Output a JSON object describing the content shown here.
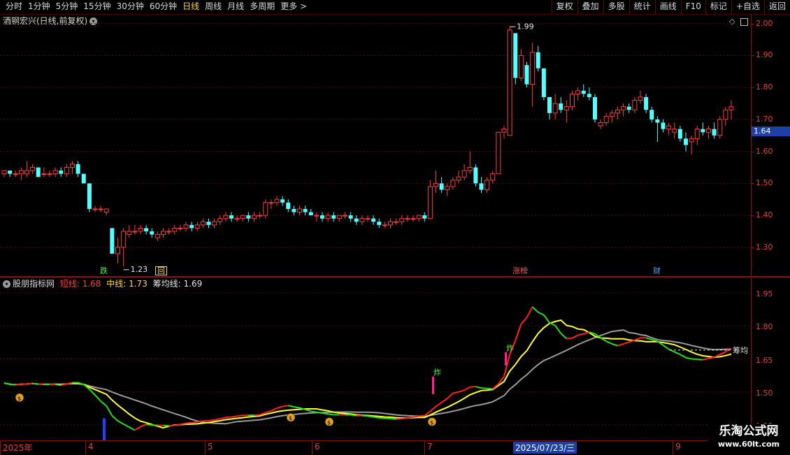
{
  "toolbar": {
    "periods": [
      "分时",
      "1分钟",
      "5分钟",
      "15分钟",
      "30分钟",
      "60分钟",
      "日线",
      "周线",
      "月线",
      "多周期",
      "更多 >"
    ],
    "active_period": "日线",
    "tools": [
      "复权",
      "叠加",
      "多股",
      "统计",
      "画线",
      "F10",
      "标记",
      "+自选",
      "返回"
    ]
  },
  "main_panel": {
    "title": "酒钢宏兴(日线,前复权)",
    "high_label": "1.99",
    "low_label": "1.23",
    "current_price": "1.64",
    "y_ticks": [
      "2.00",
      "1.90",
      "1.80",
      "1.70",
      "1.60",
      "1.50",
      "1.40",
      "1.30"
    ],
    "markers": [
      {
        "text": "跌",
        "color": "#3cff3c"
      },
      {
        "text": "回",
        "color": "#ffd24a"
      },
      {
        "text": "涨榜",
        "color": "#ff5050"
      },
      {
        "text": "财",
        "color": "#5aa0ff"
      }
    ]
  },
  "indicator_panel": {
    "name": "股朋指标网",
    "short_label": "短线: 1.68",
    "mid_label": "中线: 1.73",
    "avg_label": "筹均线: 1.69",
    "y_ticks": [
      "1.95",
      "1.80",
      "1.65",
      "1.50",
      "1.35"
    ],
    "end_label": "筹均",
    "signal_text": "炸"
  },
  "date_axis": {
    "labels": [
      "2025年",
      "4",
      "5",
      "6",
      "7",
      "2025/07/23/三",
      "9"
    ]
  },
  "watermark": {
    "line1": "乐淘公式网",
    "line2": "www.60lt.com"
  },
  "colors": {
    "up": "#ff3c3c",
    "down": "#54ffff",
    "axis": "#e04040"
  },
  "chart_data": {
    "type": "candlestick",
    "ylim": [
      1.21,
      2.03
    ],
    "candles": [
      [
        1.53,
        1.54,
        1.52,
        1.54
      ],
      [
        1.54,
        1.54,
        1.52,
        1.53
      ],
      [
        1.53,
        1.54,
        1.52,
        1.53
      ],
      [
        1.53,
        1.55,
        1.51,
        1.54
      ],
      [
        1.53,
        1.57,
        1.52,
        1.54
      ],
      [
        1.54,
        1.56,
        1.53,
        1.55
      ],
      [
        1.55,
        1.55,
        1.52,
        1.52
      ],
      [
        1.53,
        1.55,
        1.52,
        1.53
      ],
      [
        1.53,
        1.54,
        1.52,
        1.53
      ],
      [
        1.53,
        1.55,
        1.52,
        1.54
      ],
      [
        1.54,
        1.55,
        1.52,
        1.53
      ],
      [
        1.53,
        1.56,
        1.52,
        1.55
      ],
      [
        1.55,
        1.57,
        1.53,
        1.56
      ],
      [
        1.56,
        1.57,
        1.52,
        1.53
      ],
      [
        1.53,
        1.53,
        1.5,
        1.5
      ],
      [
        1.5,
        1.5,
        1.41,
        1.42
      ],
      [
        1.42,
        1.43,
        1.41,
        1.42
      ],
      [
        1.42,
        1.43,
        1.41,
        1.42
      ],
      [
        1.41,
        1.42,
        1.4,
        1.42
      ],
      [
        1.36,
        1.36,
        1.28,
        1.28
      ],
      [
        1.28,
        1.33,
        1.25,
        1.3
      ],
      [
        1.3,
        1.36,
        1.24,
        1.35
      ],
      [
        1.34,
        1.37,
        1.33,
        1.35
      ],
      [
        1.35,
        1.37,
        1.34,
        1.35
      ],
      [
        1.35,
        1.37,
        1.34,
        1.36
      ],
      [
        1.36,
        1.37,
        1.34,
        1.35
      ],
      [
        1.35,
        1.36,
        1.33,
        1.34
      ],
      [
        1.33,
        1.35,
        1.32,
        1.34
      ],
      [
        1.34,
        1.36,
        1.33,
        1.35
      ],
      [
        1.35,
        1.36,
        1.34,
        1.35
      ],
      [
        1.35,
        1.37,
        1.34,
        1.36
      ],
      [
        1.36,
        1.37,
        1.35,
        1.36
      ],
      [
        1.36,
        1.38,
        1.35,
        1.37
      ],
      [
        1.37,
        1.38,
        1.35,
        1.36
      ],
      [
        1.36,
        1.38,
        1.35,
        1.37
      ],
      [
        1.37,
        1.39,
        1.36,
        1.38
      ],
      [
        1.38,
        1.39,
        1.36,
        1.37
      ],
      [
        1.37,
        1.39,
        1.36,
        1.38
      ],
      [
        1.38,
        1.4,
        1.37,
        1.39
      ],
      [
        1.39,
        1.41,
        1.38,
        1.4
      ],
      [
        1.4,
        1.41,
        1.38,
        1.39
      ],
      [
        1.39,
        1.4,
        1.38,
        1.39
      ],
      [
        1.39,
        1.4,
        1.38,
        1.4
      ],
      [
        1.4,
        1.41,
        1.38,
        1.39
      ],
      [
        1.39,
        1.41,
        1.38,
        1.4
      ],
      [
        1.4,
        1.41,
        1.39,
        1.4
      ],
      [
        1.4,
        1.45,
        1.39,
        1.44
      ],
      [
        1.44,
        1.45,
        1.42,
        1.44
      ],
      [
        1.44,
        1.46,
        1.43,
        1.45
      ],
      [
        1.45,
        1.46,
        1.43,
        1.44
      ],
      [
        1.44,
        1.45,
        1.41,
        1.42
      ],
      [
        1.42,
        1.43,
        1.4,
        1.41
      ],
      [
        1.41,
        1.43,
        1.4,
        1.42
      ],
      [
        1.42,
        1.43,
        1.4,
        1.41
      ],
      [
        1.41,
        1.42,
        1.4,
        1.4
      ],
      [
        1.4,
        1.41,
        1.38,
        1.4
      ],
      [
        1.4,
        1.41,
        1.38,
        1.39
      ],
      [
        1.39,
        1.41,
        1.38,
        1.4
      ],
      [
        1.4,
        1.41,
        1.38,
        1.39
      ],
      [
        1.39,
        1.4,
        1.38,
        1.4
      ],
      [
        1.4,
        1.41,
        1.39,
        1.4
      ],
      [
        1.4,
        1.41,
        1.38,
        1.39
      ],
      [
        1.39,
        1.4,
        1.37,
        1.38
      ],
      [
        1.38,
        1.4,
        1.37,
        1.39
      ],
      [
        1.39,
        1.4,
        1.38,
        1.39
      ],
      [
        1.39,
        1.4,
        1.37,
        1.38
      ],
      [
        1.38,
        1.39,
        1.36,
        1.37
      ],
      [
        1.37,
        1.38,
        1.36,
        1.37
      ],
      [
        1.37,
        1.39,
        1.36,
        1.38
      ],
      [
        1.38,
        1.39,
        1.37,
        1.38
      ],
      [
        1.38,
        1.4,
        1.37,
        1.39
      ],
      [
        1.39,
        1.4,
        1.38,
        1.39
      ],
      [
        1.39,
        1.4,
        1.38,
        1.39
      ],
      [
        1.39,
        1.4,
        1.38,
        1.4
      ],
      [
        1.4,
        1.41,
        1.38,
        1.39
      ],
      [
        1.39,
        1.51,
        1.39,
        1.49
      ],
      [
        1.49,
        1.54,
        1.47,
        1.5
      ],
      [
        1.5,
        1.52,
        1.47,
        1.48
      ],
      [
        1.48,
        1.5,
        1.46,
        1.49
      ],
      [
        1.49,
        1.52,
        1.48,
        1.51
      ],
      [
        1.51,
        1.54,
        1.5,
        1.52
      ],
      [
        1.52,
        1.56,
        1.51,
        1.54
      ],
      [
        1.54,
        1.6,
        1.53,
        1.55
      ],
      [
        1.55,
        1.56,
        1.49,
        1.5
      ],
      [
        1.5,
        1.52,
        1.47,
        1.48
      ],
      [
        1.48,
        1.52,
        1.47,
        1.51
      ],
      [
        1.51,
        1.54,
        1.5,
        1.53
      ],
      [
        1.53,
        1.66,
        1.53,
        1.66
      ],
      [
        1.66,
        1.68,
        1.64,
        1.67
      ],
      [
        1.65,
        1.99,
        1.65,
        1.98
      ],
      [
        1.97,
        1.96,
        1.81,
        1.83
      ],
      [
        1.83,
        1.92,
        1.82,
        1.9
      ],
      [
        1.87,
        1.88,
        1.8,
        1.81
      ],
      [
        1.81,
        1.94,
        1.74,
        1.91
      ],
      [
        1.91,
        1.93,
        1.85,
        1.86
      ],
      [
        1.86,
        1.84,
        1.76,
        1.77
      ],
      [
        1.77,
        1.75,
        1.7,
        1.72
      ],
      [
        1.72,
        1.78,
        1.7,
        1.75
      ],
      [
        1.75,
        1.77,
        1.72,
        1.73
      ],
      [
        1.73,
        1.76,
        1.69,
        1.74
      ],
      [
        1.74,
        1.79,
        1.73,
        1.78
      ],
      [
        1.78,
        1.8,
        1.76,
        1.79
      ],
      [
        1.79,
        1.81,
        1.77,
        1.78
      ],
      [
        1.78,
        1.8,
        1.76,
        1.77
      ],
      [
        1.77,
        1.78,
        1.69,
        1.7
      ],
      [
        1.68,
        1.7,
        1.67,
        1.69
      ],
      [
        1.69,
        1.72,
        1.68,
        1.71
      ],
      [
        1.71,
        1.73,
        1.69,
        1.72
      ],
      [
        1.72,
        1.74,
        1.7,
        1.73
      ],
      [
        1.73,
        1.75,
        1.71,
        1.74
      ],
      [
        1.74,
        1.75,
        1.72,
        1.73
      ],
      [
        1.73,
        1.77,
        1.72,
        1.76
      ],
      [
        1.76,
        1.79,
        1.75,
        1.77
      ],
      [
        1.77,
        1.78,
        1.72,
        1.73
      ],
      [
        1.73,
        1.74,
        1.69,
        1.7
      ],
      [
        1.7,
        1.71,
        1.63,
        1.69
      ],
      [
        1.69,
        1.7,
        1.66,
        1.67
      ],
      [
        1.67,
        1.69,
        1.65,
        1.68
      ],
      [
        1.66,
        1.69,
        1.64,
        1.67
      ],
      [
        1.67,
        1.68,
        1.63,
        1.64
      ],
      [
        1.64,
        1.66,
        1.6,
        1.62
      ],
      [
        1.63,
        1.65,
        1.59,
        1.64
      ],
      [
        1.64,
        1.68,
        1.62,
        1.67
      ],
      [
        1.67,
        1.69,
        1.65,
        1.66
      ],
      [
        1.66,
        1.68,
        1.64,
        1.67
      ],
      [
        1.67,
        1.69,
        1.64,
        1.65
      ],
      [
        1.65,
        1.71,
        1.64,
        1.7
      ],
      [
        1.7,
        1.74,
        1.68,
        1.73
      ],
      [
        1.73,
        1.76,
        1.7,
        1.74
      ]
    ]
  }
}
